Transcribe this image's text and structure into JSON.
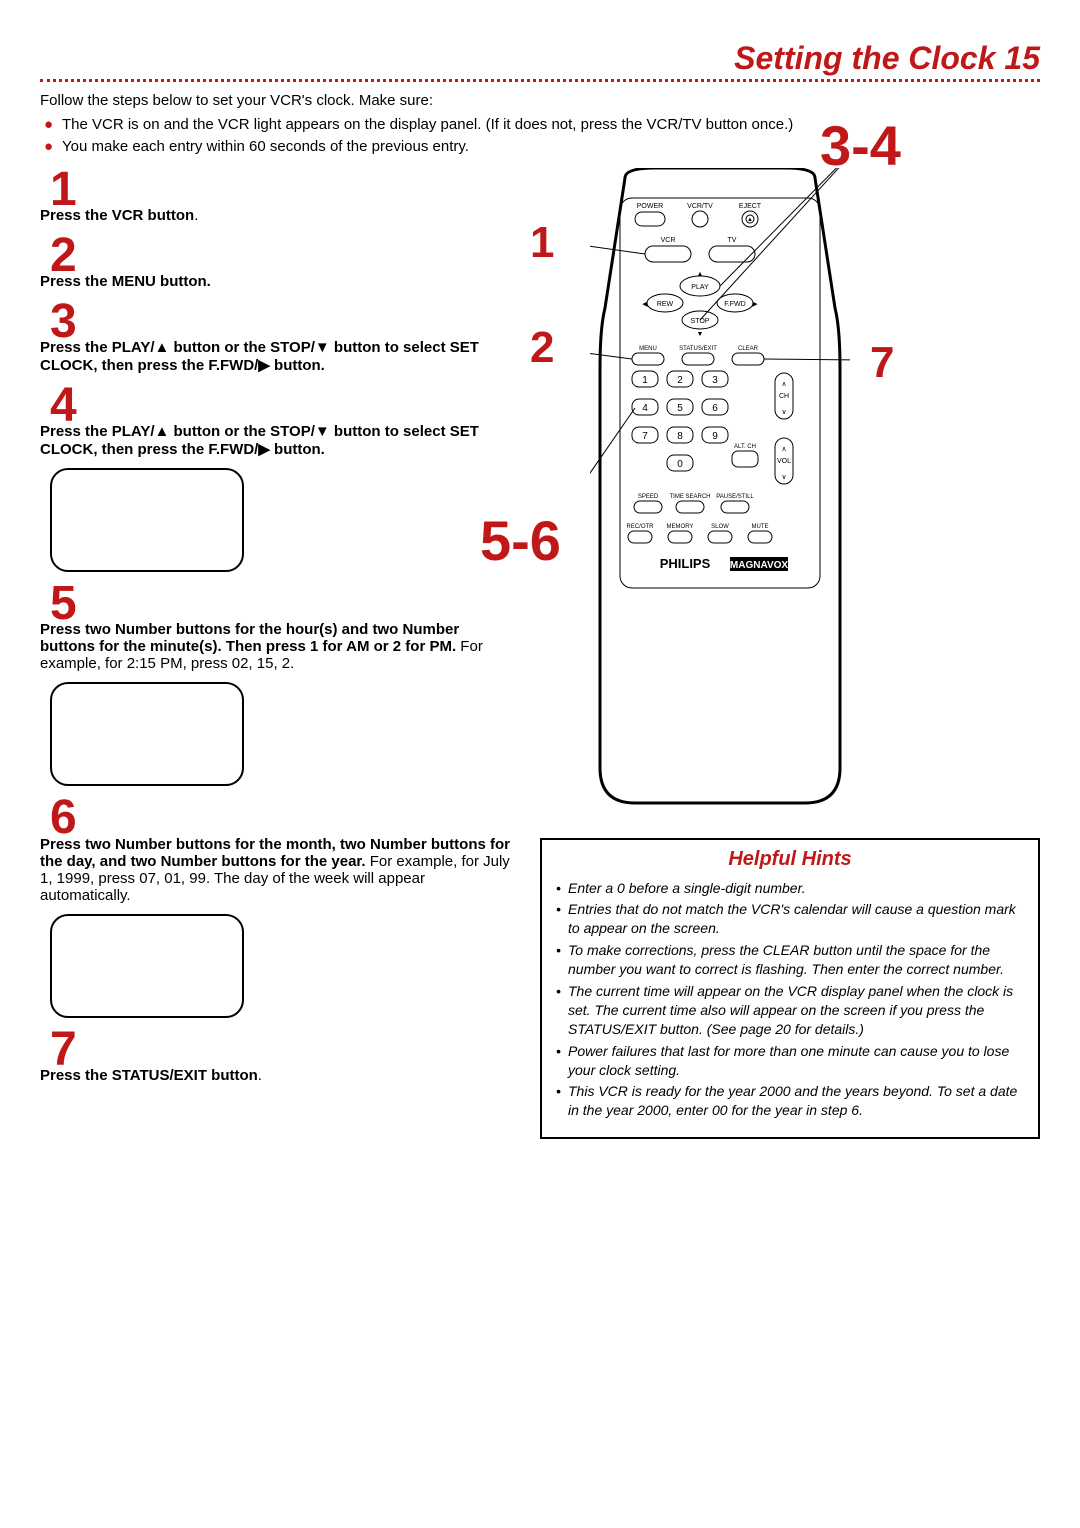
{
  "page_title": "Setting the Clock  15",
  "intro": "Follow the steps below to set your VCR's clock. Make sure:",
  "bullets": [
    "The VCR is on and the VCR light appears on the display panel. (If it does not, press the VCR/TV button once.)",
    "You make each entry within 60 seconds of the previous entry."
  ],
  "steps": [
    {
      "num": "1",
      "html": "<b>Press the VCR button</b>."
    },
    {
      "num": "2",
      "html": "<b>Press the MENU button.</b>"
    },
    {
      "num": "3",
      "html": "<b>Press the PLAY/▲ button or the STOP/▼ button to select SET CLOCK, then press the F.FWD/▶ button.</b>"
    },
    {
      "num": "4",
      "html": "<b>Press the PLAY/▲ button or the STOP/▼ button to select SET CLOCK, then press the F.FWD/▶ button.</b>",
      "screen": true
    },
    {
      "num": "5",
      "html": "<b>Press two Number buttons for the hour(s) and two Number buttons for the minute(s). Then press 1 for AM or 2 for PM.</b> For example, for 2:15 PM, press 02, 15, 2.",
      "screen": true
    },
    {
      "num": "6",
      "html": "<b>Press two Number buttons for the month, two Number buttons for the day, and two Number buttons for the year.</b> For example, for July 1, 1999, press 07, 01, 99. The day of the week will appear automatically.",
      "screen": true
    },
    {
      "num": "7",
      "html": "<b>Press the STATUS/EXIT button</b>."
    }
  ],
  "callouts": {
    "c1": "1",
    "c2": "2",
    "c34": "3-4",
    "c56": "5-6",
    "c7": "7"
  },
  "remote": {
    "row1": [
      "POWER",
      "VCR/TV",
      "EJECT"
    ],
    "row2": [
      "VCR",
      "TV"
    ],
    "transport": {
      "play": "PLAY",
      "stop": "STOP",
      "rew": "REW",
      "ffwd": "F.FWD"
    },
    "row4": [
      "MENU",
      "STATUS/EXIT",
      "CLEAR"
    ],
    "keypad": [
      "1",
      "2",
      "3",
      "4",
      "5",
      "6",
      "7",
      "8",
      "9",
      "0"
    ],
    "altch": "ALT. CH",
    "ch": "CH",
    "vol": "VOL",
    "row7": [
      "SPEED",
      "TIME SEARCH",
      "PAUSE/STILL"
    ],
    "row8": [
      "REC/OTR",
      "MEMORY",
      "SLOW",
      "MUTE"
    ],
    "brand": "PHILIPS",
    "brand2": "MAGNAVOX"
  },
  "hints_title": "Helpful Hints",
  "hints": [
    "Enter a 0 before a single-digit number.",
    "Entries that do not match the VCR's calendar will cause a question mark to appear on the screen.",
    "To make corrections, press the CLEAR button until the space for the number you want to correct is flashing. Then enter the correct number.",
    "The current time will appear on the VCR display panel when the clock is set. The current time also will appear on the screen if you press the STATUS/EXIT button. (See page 20 for details.)",
    "Power failures that last for more than one minute can cause you to lose your clock setting.",
    "This VCR is ready for the year 2000 and the years beyond. To set a date in the year 2000, enter 00 for the year in step 6."
  ]
}
